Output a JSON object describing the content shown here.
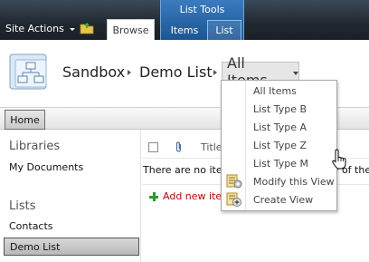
{
  "ribbon": {
    "site_actions_label": "Site Actions",
    "browse_tab": "Browse",
    "list_tools_title": "List Tools",
    "items_tab": "Items",
    "list_tab": "List"
  },
  "breadcrumb": {
    "site": "Sandbox",
    "list": "Demo List",
    "view_selector": "All Items"
  },
  "topnav": {
    "home_tab": "Home"
  },
  "leftnav": {
    "libraries_heading": "Libraries",
    "libraries_items": [
      "My Documents"
    ],
    "lists_heading": "Lists",
    "lists_items": [
      "Contacts",
      "Demo List"
    ],
    "selected": "Demo List"
  },
  "list_view": {
    "title_column": "Title",
    "empty_message": "There are no items to show in this view of the",
    "add_new_item": "Add new item"
  },
  "view_menu": {
    "items": [
      {
        "label": "All Items"
      },
      {
        "label": "List Type B"
      },
      {
        "label": "List Type A"
      },
      {
        "label": "List Type Z"
      },
      {
        "label": "List Type M"
      },
      {
        "label": "Modify this View",
        "icon": "modify-view-icon"
      },
      {
        "label": "Create View",
        "icon": "create-view-icon"
      }
    ]
  },
  "colors": {
    "ribbon_dark": "#20282f",
    "list_tools_blue": "#2a66a8",
    "add_new_red": "#cc0000",
    "plus_green": "#2a9c2a"
  }
}
